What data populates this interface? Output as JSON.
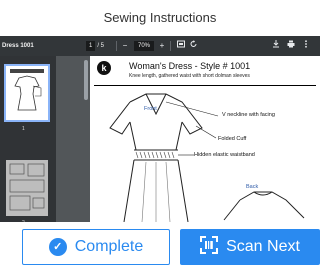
{
  "app": {
    "title": "Sewing Instructions"
  },
  "viewer": {
    "file_name": "Dress 1001",
    "page_current": "1",
    "page_total": "/ 5",
    "zoom": "70%",
    "zoom_minus": "−",
    "zoom_plus": "+"
  },
  "thumbnails": [
    {
      "number": "1"
    },
    {
      "number": "2"
    }
  ],
  "document": {
    "logo_letter": "k",
    "title": "Woman's Dress - Style # 1001",
    "subtitle": "Knee length, gathered waist with short dolman sleeves",
    "labels": {
      "front": "Front",
      "v_neckline": "V neckline with facing",
      "folded_cuff": "Folded Cuff",
      "hidden_waistband": "Hidden elastic waistband",
      "back": "Back"
    }
  },
  "actions": {
    "complete": "Complete",
    "scan_next": "Scan Next"
  },
  "colors": {
    "accent": "#2a8af0",
    "viewer_bg": "#525659",
    "toolbar_bg": "#323639"
  }
}
